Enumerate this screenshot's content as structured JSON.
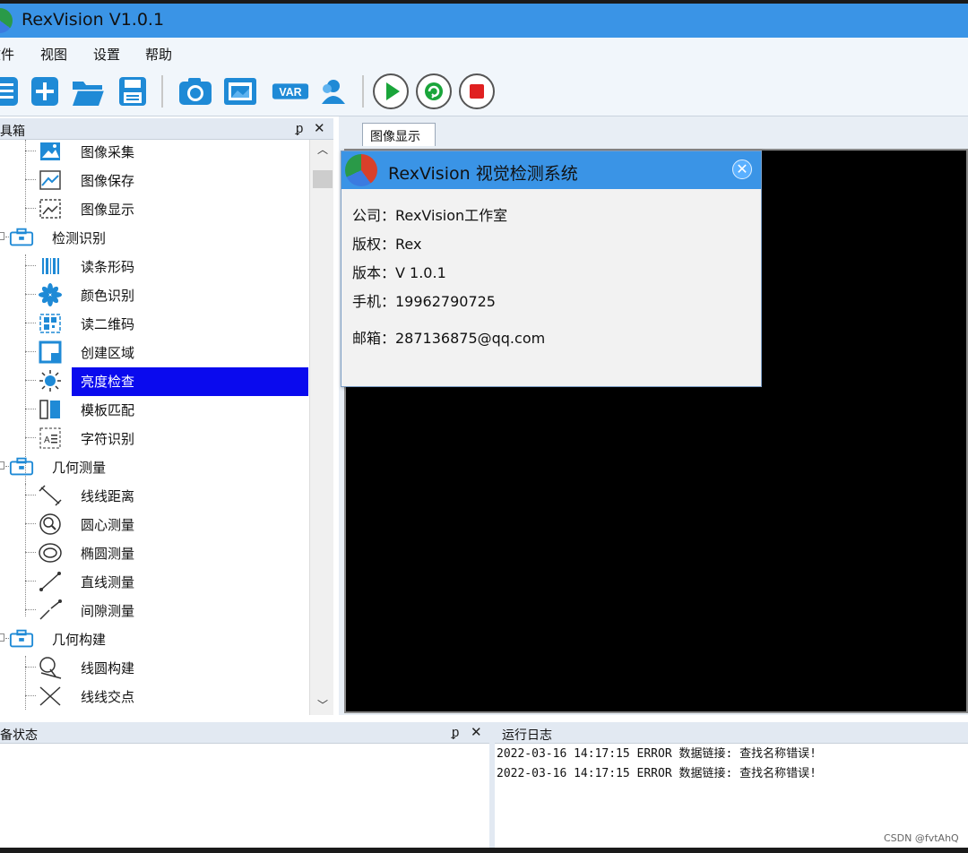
{
  "window": {
    "title": "RexVision V1.0.1"
  },
  "menu": [
    "文件",
    "视图",
    "设置",
    "帮助"
  ],
  "toolbar": {
    "buttons": [
      {
        "name": "list-icon"
      },
      {
        "name": "new-file-icon"
      },
      {
        "name": "open-folder-icon"
      },
      {
        "name": "save-icon"
      },
      {
        "name": "camera-icon"
      },
      {
        "name": "image-icon"
      },
      {
        "name": "var-icon",
        "label": "VAR"
      },
      {
        "name": "user-icon"
      },
      {
        "name": "run-icon"
      },
      {
        "name": "loop-icon"
      },
      {
        "name": "stop-icon"
      }
    ]
  },
  "toolbox": {
    "title": "工具箱",
    "pin": "ᵱ",
    "close": "✕",
    "items": [
      {
        "label": "图像采集",
        "type": "leaf",
        "icon": "image-capture-icon"
      },
      {
        "label": "图像保存",
        "type": "leaf",
        "icon": "image-save-icon"
      },
      {
        "label": "图像显示",
        "type": "leaf",
        "icon": "image-display-icon"
      },
      {
        "label": "检测识别",
        "type": "group",
        "icon": "toolbox-icon"
      },
      {
        "label": "读条形码",
        "type": "leaf",
        "icon": "barcode-icon"
      },
      {
        "label": "颜色识别",
        "type": "leaf",
        "icon": "color-icon"
      },
      {
        "label": "读二维码",
        "type": "leaf",
        "icon": "qrcode-icon"
      },
      {
        "label": "创建区域",
        "type": "leaf",
        "icon": "region-icon"
      },
      {
        "label": "亮度检查",
        "type": "leaf",
        "icon": "brightness-icon",
        "selected": true
      },
      {
        "label": "模板匹配",
        "type": "leaf",
        "icon": "template-icon"
      },
      {
        "label": "字符识别",
        "type": "leaf",
        "icon": "ocr-icon"
      },
      {
        "label": "几何测量",
        "type": "group",
        "icon": "toolbox-icon"
      },
      {
        "label": "线线距离",
        "type": "leaf",
        "icon": "line-distance-icon"
      },
      {
        "label": "圆心测量",
        "type": "leaf",
        "icon": "circle-center-icon"
      },
      {
        "label": "椭圆测量",
        "type": "leaf",
        "icon": "ellipse-icon"
      },
      {
        "label": "直线测量",
        "type": "leaf",
        "icon": "line-measure-icon"
      },
      {
        "label": "间隙测量",
        "type": "leaf",
        "icon": "gap-icon"
      },
      {
        "label": "几何构建",
        "type": "group",
        "icon": "toolbox-icon"
      },
      {
        "label": "线圆构建",
        "type": "leaf",
        "icon": "line-circle-icon"
      },
      {
        "label": "线线交点",
        "type": "leaf",
        "icon": "intersection-icon"
      }
    ]
  },
  "document": {
    "tab": "图像显示"
  },
  "dialog": {
    "title": "RexVision 视觉检测系统",
    "company": "公司：RexVision工作室",
    "copyright": "版权：Rex",
    "version": "版本：V 1.0.1",
    "phone": "手机：19962790725",
    "email": "邮箱：287136875@qq.com"
  },
  "device_status": {
    "title": "设备状态",
    "pin": "ᵱ",
    "close": "✕"
  },
  "log": {
    "title": "运行日志",
    "lines": [
      "2022-03-16 14:17:15 ERROR 数据链接: 查找名称错误!",
      "2022-03-16 14:17:15 ERROR 数据链接: 查找名称错误!"
    ]
  },
  "watermark": "CSDN @fvtAhQ",
  "colors": {
    "titlebar": "#3a94e6",
    "selection": "#0a0aee",
    "icon_blue": "#1f8ad6"
  }
}
